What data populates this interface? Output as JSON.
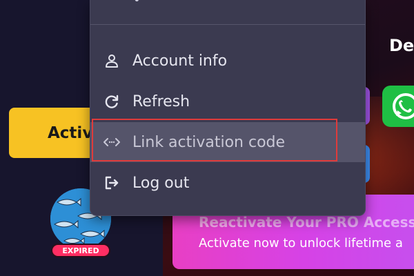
{
  "left": {
    "activate_label": "Activ",
    "expired_badge": "EXPIRED"
  },
  "right": {
    "heading": "De",
    "promo_title": "Reactivate Your PRO Access",
    "promo_subtitle": "Activate now to unlock lifetime a"
  },
  "menu": {
    "items": [
      {
        "label": "Account info",
        "icon": "user-icon"
      },
      {
        "label": "Refresh",
        "icon": "refresh-icon"
      },
      {
        "label": "Link activation code",
        "icon": "link-code-icon"
      },
      {
        "label": "Log out",
        "icon": "logout-icon"
      }
    ]
  },
  "colors": {
    "accent_yellow": "#f7c223",
    "expired_red": "#ff2e63",
    "menu_bg": "#3b3a50",
    "highlight_border": "#e03b3b"
  }
}
